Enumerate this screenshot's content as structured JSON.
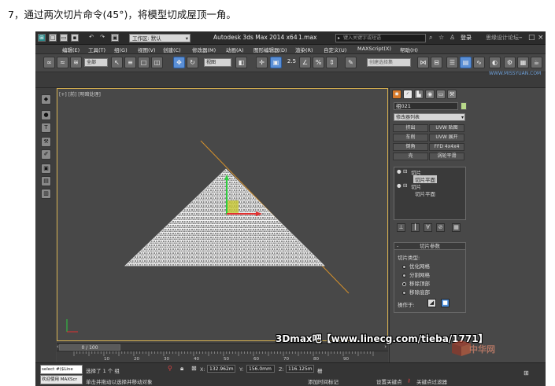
{
  "caption": "7，通过两次切片命令(45°)，将模型切成屋顶一角。",
  "titlebar": {
    "workspace": "工作区: 默认",
    "app_title": "Autodesk 3ds Max  2014 x64",
    "file_name": "1.max",
    "search_placeholder": "键入关键字或短语",
    "login": "登录",
    "watermark": "思缘设计论坛"
  },
  "menu": [
    "编辑(E)",
    "工具(T)",
    "组(G)",
    "视图(V)",
    "创建(C)",
    "修改器(M)",
    "动画(A)",
    "图形编辑器(D)",
    "渲染(R)",
    "自定义(U)",
    "MAXScript(X)",
    "帮助(H)"
  ],
  "toolbar": {
    "selection_filter": "全部",
    "reference_coord": "视图",
    "named_selection_sets": "创建选择集",
    "snap_value": "2.5"
  },
  "viewport": {
    "label": "[+] [前] [明暗处理]",
    "background_color": "#484848",
    "active_border_color": "#d6b050",
    "slice_plane_color": "#d4902c"
  },
  "timeline": {
    "frame_counter": "0 / 100",
    "ticks": [
      "0",
      "10",
      "20",
      "30",
      "40",
      "50",
      "60",
      "70",
      "80",
      "90",
      "100"
    ]
  },
  "command_panel": {
    "object_name": "组021",
    "modifier_list": "修改器列表",
    "mod_buttons": [
      "挤出",
      "UVW 贴图",
      "车削",
      "UVW 展开",
      "倒角",
      "FFD 4x4x4",
      "壳",
      "涡轮平滑"
    ],
    "stack": [
      {
        "name": "切片",
        "expanded": true
      },
      {
        "name": "切片平面",
        "sub": true,
        "selected": true
      },
      {
        "name": "切片",
        "expanded": true
      },
      {
        "name": "切片平面",
        "sub": true,
        "selected": false
      }
    ],
    "rollout": {
      "title": "切片参数",
      "slice_type_label": "切片类型:",
      "options": [
        {
          "label": "优化网格",
          "checked": false
        },
        {
          "label": "分割网格",
          "checked": false
        },
        {
          "label": "移除顶部",
          "checked": true
        },
        {
          "label": "移除底部",
          "checked": false
        }
      ],
      "operate_on": "操作于:"
    }
  },
  "status": {
    "maxscript_line1": "select #($Line",
    "maxscript_line2": "欢迎使用 MAXScr",
    "selection_info": "选择了 1 个 组",
    "prompt": "单击并拖动以选择并移动对象",
    "x_label": "X:",
    "x_value": "132.962m",
    "y_label": "Y:",
    "y_value": "156.0mm",
    "z_label": "Z:",
    "z_value": "116.125m",
    "grid_text": "栅",
    "add_time_tag": "添加时间标记",
    "set_key": "设置关键点",
    "key_filters": "关键点过滤器"
  },
  "watermark_url": "3Dmax吧【www.linecg.com/tieba/1771】",
  "watermark_site": "WWW.MISSYUAN.COM",
  "watermark_logo": "中华网"
}
